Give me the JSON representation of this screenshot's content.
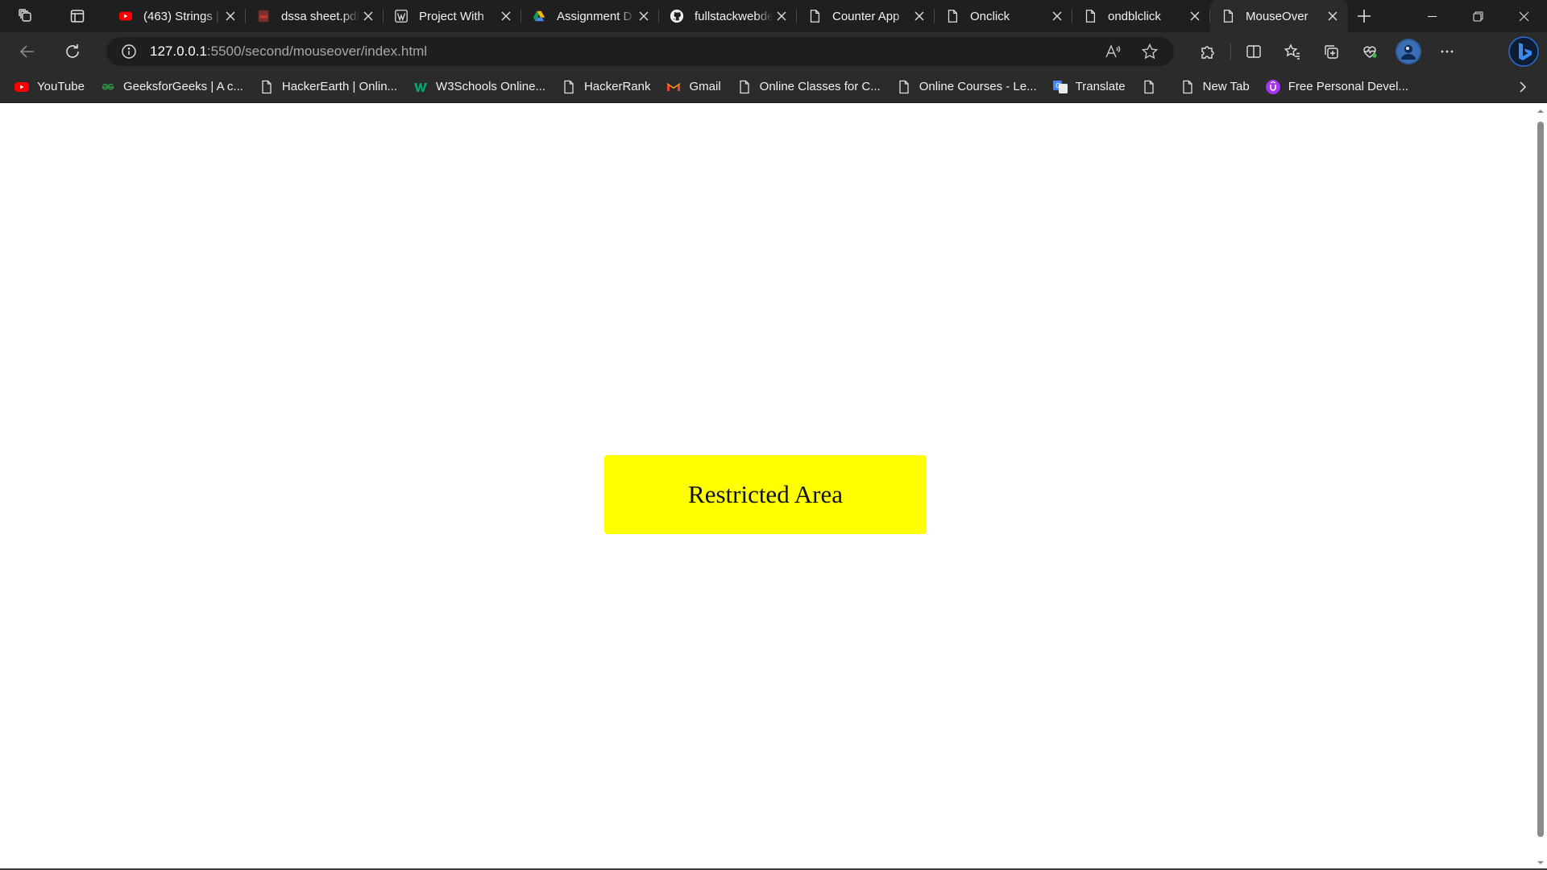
{
  "tabs": [
    {
      "title": "(463) Strings | ",
      "icon": "youtube-icon",
      "active": false
    },
    {
      "title": "dssa sheet.pdf",
      "icon": "pdf-icon",
      "active": false
    },
    {
      "title": "Project With ",
      "icon": "wordpress-icon",
      "active": false
    },
    {
      "title": "Assignment D",
      "icon": "drive-icon",
      "active": false
    },
    {
      "title": "fullstackwebde",
      "icon": "github-icon",
      "active": false
    },
    {
      "title": "Counter App",
      "icon": "page-icon",
      "active": false
    },
    {
      "title": "Onclick",
      "icon": "page-icon",
      "active": false
    },
    {
      "title": "ondblclick",
      "icon": "page-icon",
      "active": false
    },
    {
      "title": "MouseOver",
      "icon": "page-icon",
      "active": true
    }
  ],
  "address": {
    "host": "127.0.0.1",
    "path": ":5500/second/mouseover/index.html"
  },
  "bookmarks": [
    {
      "label": "YouTube",
      "icon": "youtube-icon"
    },
    {
      "label": "GeeksforGeeks | A c...",
      "icon": "gfg-icon"
    },
    {
      "label": "HackerEarth | Onlin...",
      "icon": "page-icon"
    },
    {
      "label": "W3Schools Online...",
      "icon": "w3schools-icon"
    },
    {
      "label": "HackerRank",
      "icon": "page-icon"
    },
    {
      "label": "Gmail",
      "icon": "gmail-icon"
    },
    {
      "label": "Online Classes for C...",
      "icon": "page-icon"
    },
    {
      "label": "Online Courses - Le...",
      "icon": "page-icon"
    },
    {
      "label": "Translate",
      "icon": "translate-icon"
    },
    {
      "label": "",
      "icon": "page-icon"
    },
    {
      "label": "New Tab",
      "icon": "page-icon"
    },
    {
      "label": "Free Personal Devel...",
      "icon": "udemy-icon"
    }
  ],
  "page": {
    "box_text": "Restricted Area",
    "box_color": "#ffff00"
  },
  "colors": {
    "tabstrip": "#1f1f1f",
    "toolbar": "#2b2b2b",
    "omnibox": "#1e1e1e"
  }
}
